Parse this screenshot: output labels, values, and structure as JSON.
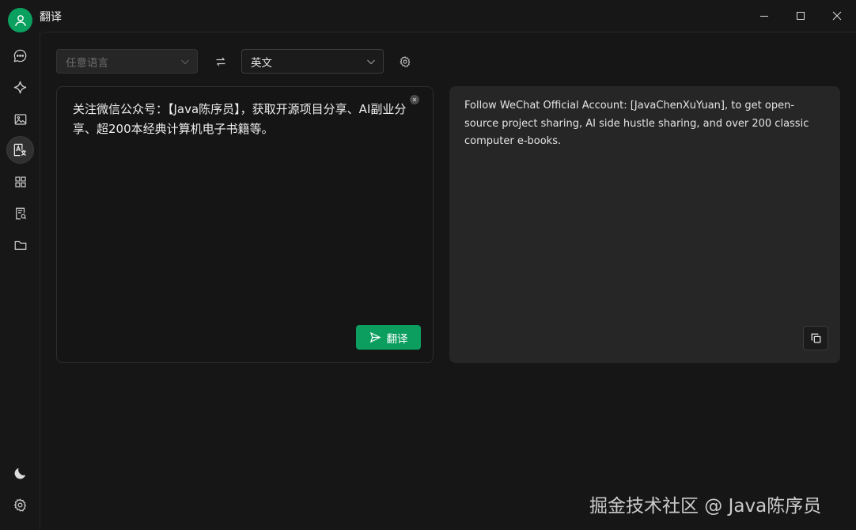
{
  "app": {
    "title": "翻译"
  },
  "icons": {
    "avatar": "user-icon",
    "sidebar": [
      "chat-icon",
      "sparkle-icon",
      "image-icon",
      "translate-icon",
      "grid-icon",
      "doc-search-icon",
      "folder-icon",
      "moon-icon",
      "gear-icon"
    ]
  },
  "toolbar": {
    "source_language_placeholder": "任意语言",
    "target_language": "英文"
  },
  "source": {
    "text": "关注微信公众号：【Java陈序员】，获取开源项目分享、AI副业分享、超200本经典计算机电子书籍等。",
    "translate_label": "翻译"
  },
  "result": {
    "text": "Follow WeChat Official Account: [JavaChenXuYuan], to get open-source project sharing, AI side hustle sharing, and over 200 classic computer e-books."
  },
  "watermark": "掘金技术社区 @ Java陈序员",
  "colors": {
    "accent": "#0b9e5f",
    "background": "#161616",
    "panel": "#262626"
  }
}
